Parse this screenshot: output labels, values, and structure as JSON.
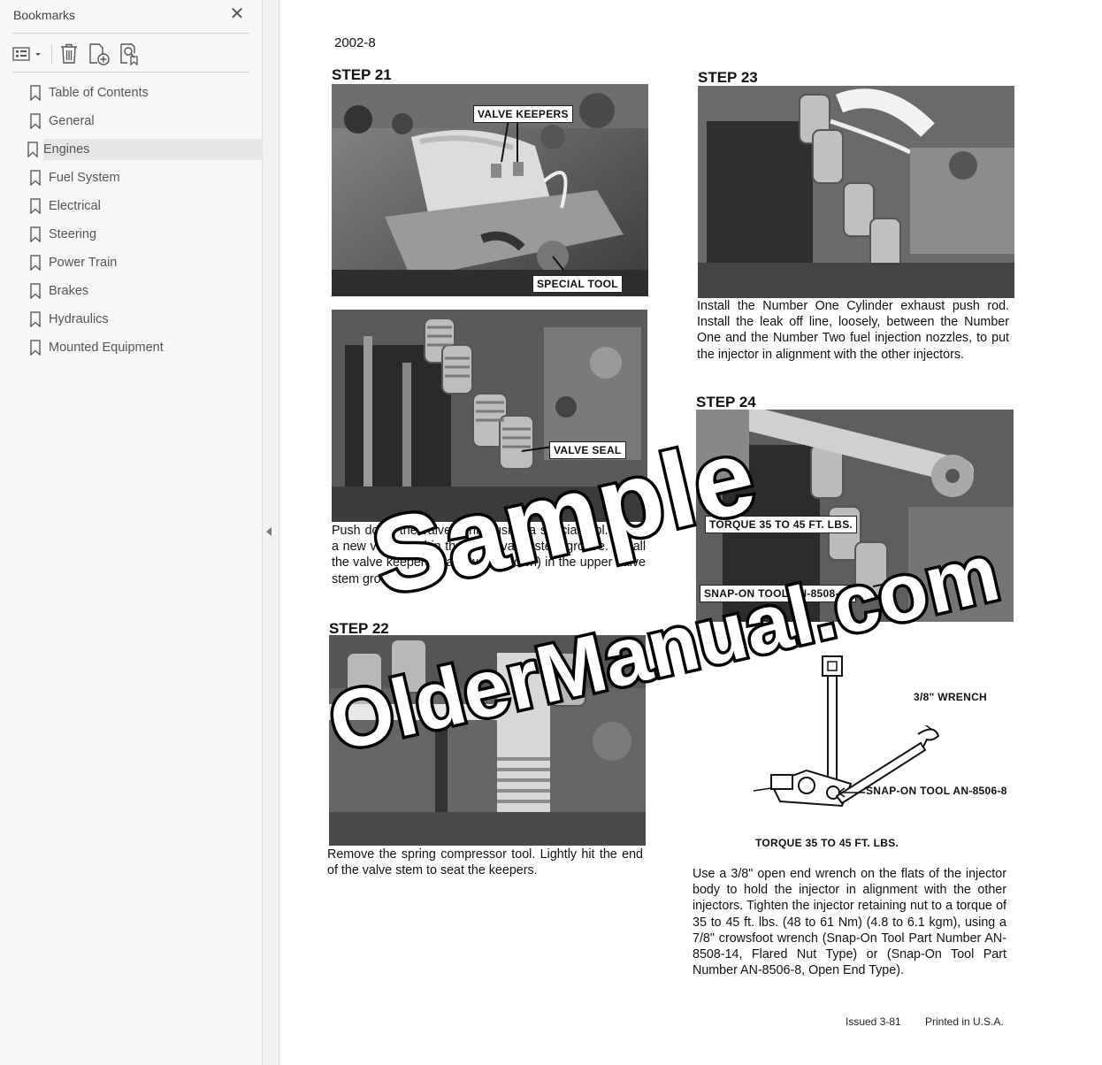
{
  "sidebar": {
    "title": "Bookmarks",
    "close_icon": "close-icon",
    "toolbar": [
      {
        "name": "options-menu",
        "icon": "list-options-icon"
      },
      {
        "name": "delete-bookmark",
        "icon": "trash-icon"
      },
      {
        "name": "add-bookmark",
        "icon": "add-bookmark-icon"
      },
      {
        "name": "find-bookmark",
        "icon": "find-bookmark-icon"
      }
    ],
    "items": [
      {
        "label": "Table of Contents"
      },
      {
        "label": "General"
      },
      {
        "label": "Engines",
        "selected": true
      },
      {
        "label": "Fuel System"
      },
      {
        "label": "Electrical"
      },
      {
        "label": "Steering"
      },
      {
        "label": "Power Train"
      },
      {
        "label": "Brakes"
      },
      {
        "label": "Hydraulics"
      },
      {
        "label": "Mounted Equipment"
      }
    ]
  },
  "page": {
    "number": "2002-8",
    "step21": {
      "title": "STEP 21",
      "callout_keepers": "VALVE KEEPERS",
      "callout_tool": "SPECIAL TOOL",
      "callout_seal": "VALVE SEAL",
      "text": "Push down the valve spring using a special tool. Install a new valve seal in the lower valve stem groove. Install the valve keepers (narrow end down) in the upper valve stem groove."
    },
    "step22": {
      "title": "STEP 22",
      "text": "Remove the spring compressor tool. Lightly hit the end of the valve stem to seat the keepers."
    },
    "step23": {
      "title": "STEP 23",
      "text": "Install the Number One Cylinder exhaust push rod. Install the leak off line, loosely, between the Number One and the Number Two fuel injection nozzles, to put the injector in alignment with the other injectors."
    },
    "step24": {
      "title": "STEP 24",
      "callout_torque": "TORQUE 35 TO 45 FT. LBS.",
      "callout_snapon": "SNAP-ON TOOL AN-8508-14",
      "diagram_wrench": "3/8\" WRENCH",
      "diagram_tool": "SNAP-ON TOOL AN-8506-8",
      "diagram_torque": "TORQUE 35 TO 45 FT. LBS.",
      "text": "Use a 3/8\" open end wrench on the flats of the injector body to hold the injector in alignment with the other injectors. Tighten the injector retaining nut to a torque of 35 to 45 ft. lbs. (48 to 61 Nm) (4.8 to 6.1 kgm), using a 7/8\" crowsfoot wrench (Snap-On Tool Part Number AN-8508-14, Flared Nut Type) or (Snap-On Tool Part Number AN-8506-8, Open End Type)."
    },
    "footer_issued": "Issued 3-81",
    "footer_printed": "Printed in U.S.A.",
    "watermark_line1": "Sample",
    "watermark_line2": "OlderManual.com"
  },
  "colors": {
    "sidebar_bg": "#f7f7f7",
    "selected_bg": "#e6e6e6",
    "icon": "#555555"
  }
}
